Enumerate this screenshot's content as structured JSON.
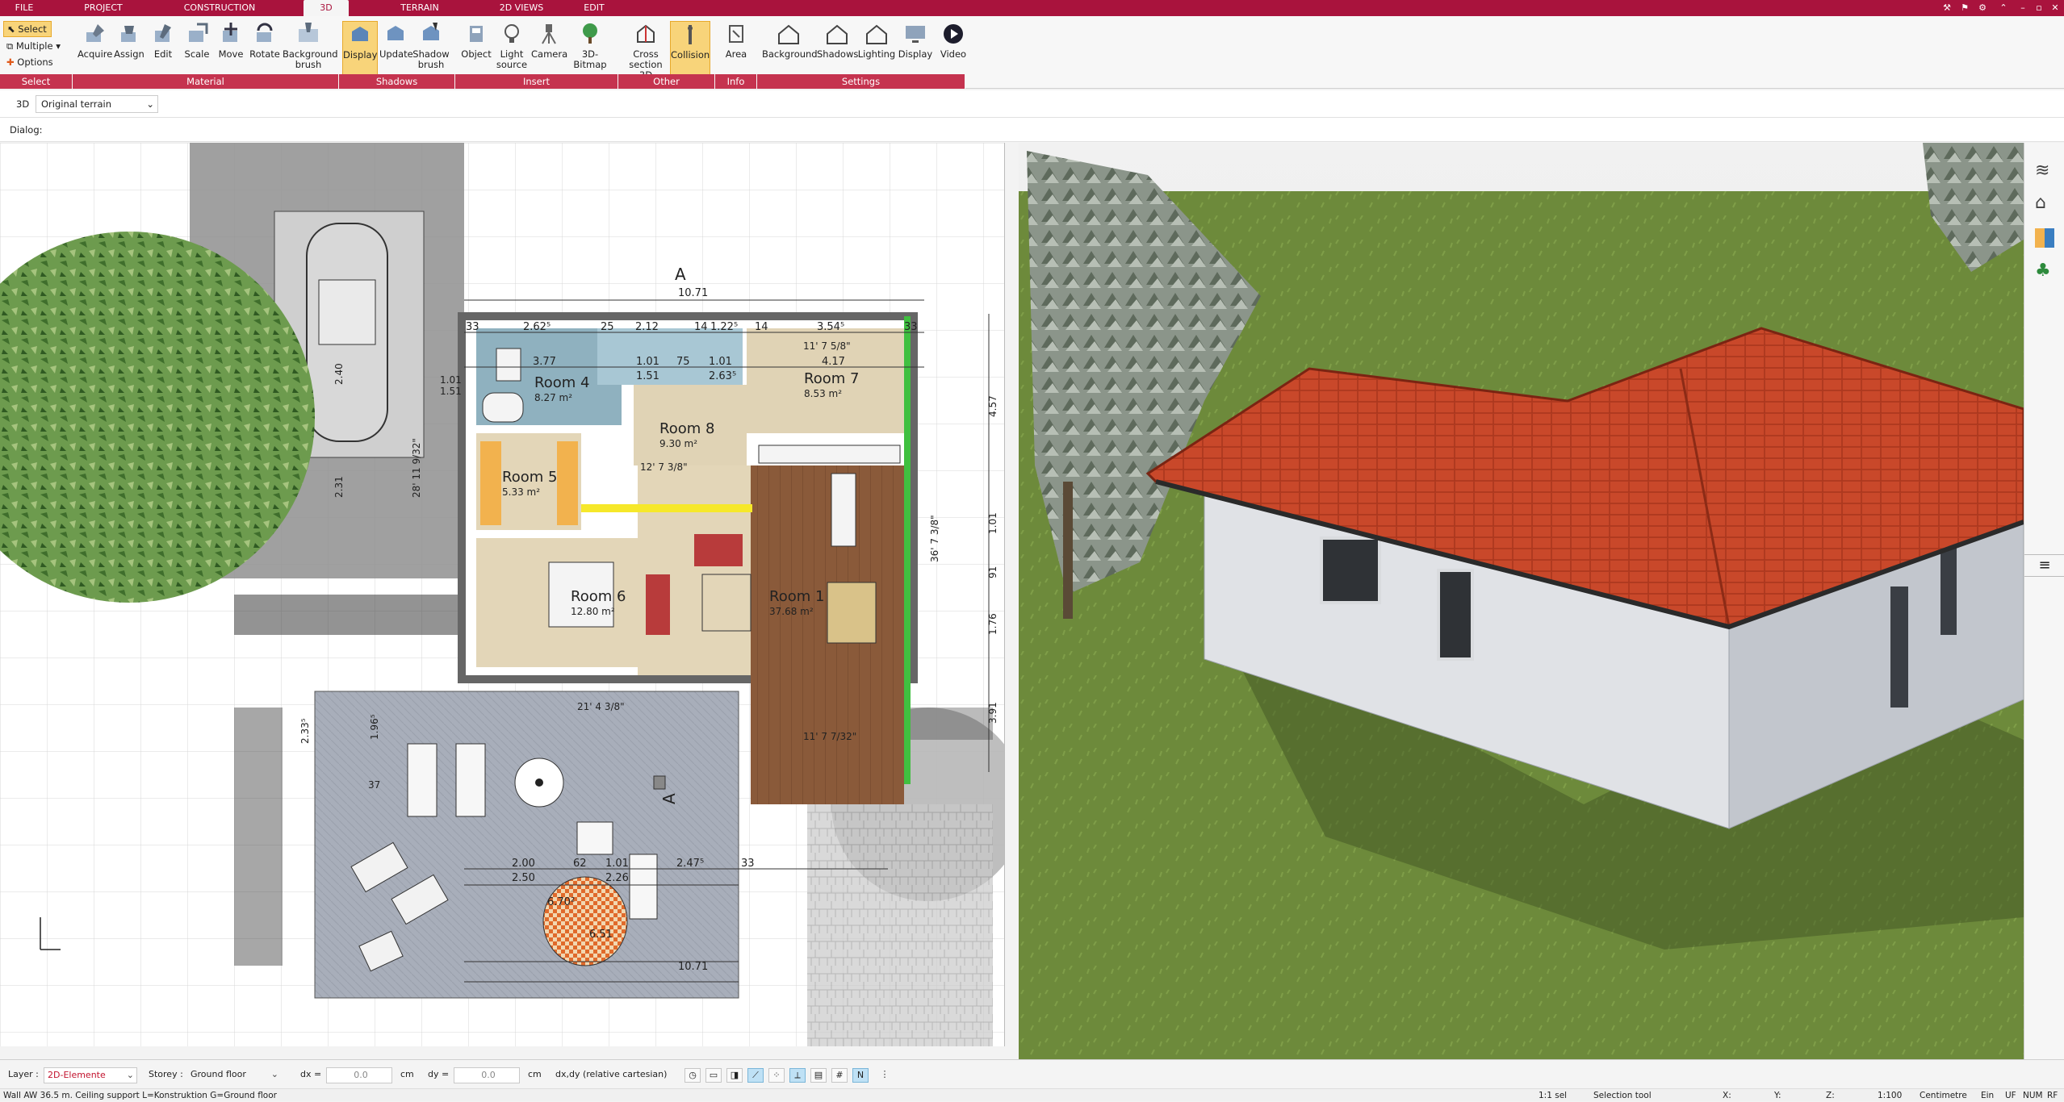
{
  "menu": {
    "tabs": [
      "FILE",
      "PROJECT",
      "CONSTRUCTION",
      "3D",
      "TERRAIN",
      "2D VIEWS",
      "EDIT"
    ],
    "active_tab": "3D"
  },
  "ribbon": {
    "select": {
      "select_label": "Select",
      "multiple_label": "Multiple",
      "options_label": "Options"
    },
    "material_buttons": [
      "Acquire",
      "Assign",
      "Edit",
      "Scale",
      "Move",
      "Rotate",
      "Background brush"
    ],
    "shadow_buttons": [
      "Display",
      "Update",
      "Shadow brush"
    ],
    "insert_buttons": [
      "Object",
      "Light source",
      "Camera",
      "3D-Bitmap"
    ],
    "other_buttons": [
      "Cross section 3D",
      "Collision"
    ],
    "info_buttons": [
      "Area"
    ],
    "settings_buttons": [
      "Background",
      "Shadows",
      "Lighting",
      "Display",
      "Video"
    ],
    "groups": [
      "Select",
      "Material",
      "Shadows",
      "Insert",
      "Other",
      "Info",
      "Settings"
    ]
  },
  "subbar": {
    "mode_label": "3D",
    "terrain_value": "Original terrain",
    "dialog_label": "Dialog:"
  },
  "plan": {
    "rooms": [
      {
        "name": "Room 4",
        "area": "8.27 m²"
      },
      {
        "name": "Room 7",
        "area": "8.53 m²"
      },
      {
        "name": "Room 8",
        "area": "9.30 m²"
      },
      {
        "name": "Room 5",
        "area": "5.33 m²"
      },
      {
        "name": "Room 6",
        "area": "12.80 m²"
      },
      {
        "name": "Room 1",
        "area": "37.68 m²"
      }
    ],
    "dimensions": {
      "top_total": "10.71",
      "top_row1": [
        "33",
        "2.62⁵",
        "25",
        "2.12",
        "14",
        "1.22⁵",
        "14",
        "3.54⁵",
        "33"
      ],
      "top_row2": [
        "3.77",
        "1.01",
        "75",
        "1.01",
        "4.17"
      ],
      "top_row3": [
        "1.51",
        "2.63⁵"
      ],
      "bottom_total": "10.71",
      "terrace_row": [
        "2.00",
        "62",
        "1.01",
        "2.47⁵",
        "33"
      ],
      "terrace_row2": [
        "2.50",
        "2.26"
      ],
      "right_col": [
        "4.57",
        "1.01",
        "91",
        "1.76",
        "3.91"
      ],
      "imperial": [
        "28' 11 9/32\"",
        "36' 7 3/8\"",
        "21' 4 3/8\"",
        "12' 7 3/8\"",
        "11' 7 5/8\"",
        "11' 7 7/32\""
      ],
      "left_col": [
        "1.01",
        "1.51",
        "2.40",
        "2.31",
        "1.96⁵",
        "2.33⁵",
        "37"
      ],
      "circle_labels": [
        "6.70²",
        "6.51"
      ]
    }
  },
  "statusbar": {
    "layer_label": "Layer :",
    "layer_value": "2D-Elemente",
    "storey_label": "Storey :",
    "storey_value": "Ground floor",
    "dx_label": "dx =",
    "dx_value": "0.0",
    "dx_unit": "cm",
    "dy_label": "dy =",
    "dy_value": "0.0",
    "dy_unit": "cm",
    "coord_mode": "dx,dy (relative cartesian)"
  },
  "footer": {
    "message": "Wall AW 36.5 m. Ceiling support L=Konstruktion G=Ground floor",
    "sel": "1:1 sel",
    "tool": "Selection tool",
    "x": "X:",
    "y": "Y:",
    "z": "Z:",
    "scale": "1:100",
    "unit": "Centimetre",
    "ein": "Ein",
    "uf": "UF",
    "num": "NUM",
    "rf": "RF"
  },
  "colors": {
    "brand": "#a9133d",
    "group": "#c5334f",
    "roof": "#c23b22",
    "grass": "#6b8a3a",
    "wall": "#d6d8dc"
  }
}
